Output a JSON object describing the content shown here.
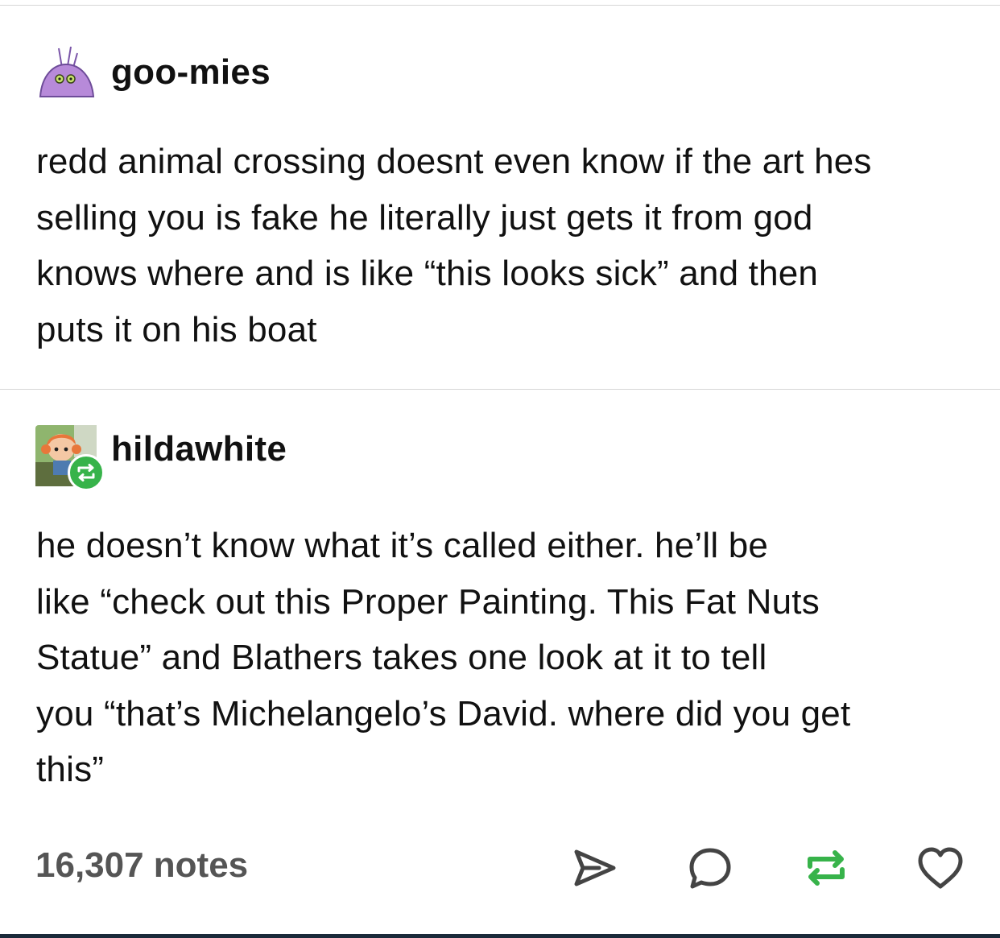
{
  "posts": [
    {
      "author": "goo-mies",
      "avatar_icon": "purple-blob-avatar-icon",
      "lines": [
        "redd animal crossing doesnt even know if the art hes",
        "selling you is fake he literally just gets it from god",
        "knows where and is like “this looks sick” and then",
        "puts it on his boat"
      ]
    },
    {
      "author": "hildawhite",
      "avatar_icon": "villager-avatar-icon",
      "badge_icon": "reblog-badge-icon",
      "lines": [
        "he doesn’t know what it’s called either. he’ll be",
        "like “check out this Proper Painting. This Fat Nuts",
        "Statue” and Blathers takes one look at it to tell",
        "you “that’s Michelangelo’s David. where did you get",
        "this”"
      ]
    }
  ],
  "footer": {
    "notes": "16,307 notes",
    "actions": [
      "share-icon",
      "reply-icon",
      "reblog-icon",
      "heart-icon"
    ]
  },
  "colors": {
    "reblog_green": "#37b34a",
    "notes_gray": "#555555",
    "divider": "#d6d6d6"
  }
}
